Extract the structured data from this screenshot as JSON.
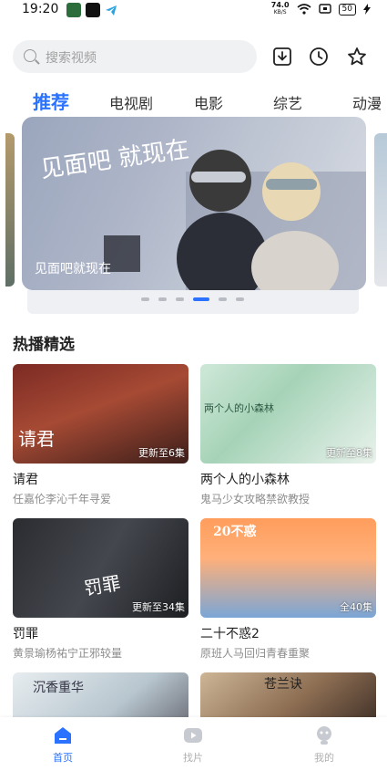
{
  "status_bar": {
    "time": "19:20",
    "net_speed_value": "74.0",
    "net_speed_unit": "KB/S",
    "battery": "50"
  },
  "search": {
    "placeholder": "搜索视频"
  },
  "toolbar_icons": [
    "download-icon",
    "history-clock-icon",
    "star-icon"
  ],
  "tabs": [
    {
      "label": "推荐",
      "active": true
    },
    {
      "label": "电视剧",
      "active": false
    },
    {
      "label": "电影",
      "active": false
    },
    {
      "label": "综艺",
      "active": false
    },
    {
      "label": "动漫",
      "active": false
    }
  ],
  "banner": {
    "title": "见面吧就现在",
    "art_text": "见面吧 就现在",
    "active_index": 3,
    "dot_count": 6
  },
  "section": {
    "title": "热播精选"
  },
  "cards": [
    {
      "title": "请君",
      "subtitle": "任嘉伦李沁千年寻爱",
      "badge": "更新至6集",
      "poster_text": "请君"
    },
    {
      "title": "两个人的小森林",
      "subtitle": "鬼马少女攻略禁欲教授",
      "badge": "更新至8集",
      "poster_text": "两个人的小森林"
    },
    {
      "title": "罚罪",
      "subtitle": "黄景瑜杨祐宁正邪较量",
      "badge": "更新至34集",
      "poster_text": "罚罪"
    },
    {
      "title": "二十不惑2",
      "subtitle": "原班人马回归青春重聚",
      "badge": "全40集",
      "poster_text": "20不惑"
    },
    {
      "title": "",
      "subtitle": "",
      "badge": "",
      "poster_text": "沉香重华"
    },
    {
      "title": "",
      "subtitle": "",
      "badge": "",
      "poster_text": "苍兰诀"
    }
  ],
  "bottom_nav": [
    {
      "label": "首页",
      "icon": "home-icon",
      "active": true
    },
    {
      "label": "找片",
      "icon": "play-video-icon",
      "active": false
    },
    {
      "label": "我的",
      "icon": "profile-icon",
      "active": false
    }
  ],
  "colors": {
    "accent": "#2a72ff",
    "inactive": "#b0b0b0"
  }
}
